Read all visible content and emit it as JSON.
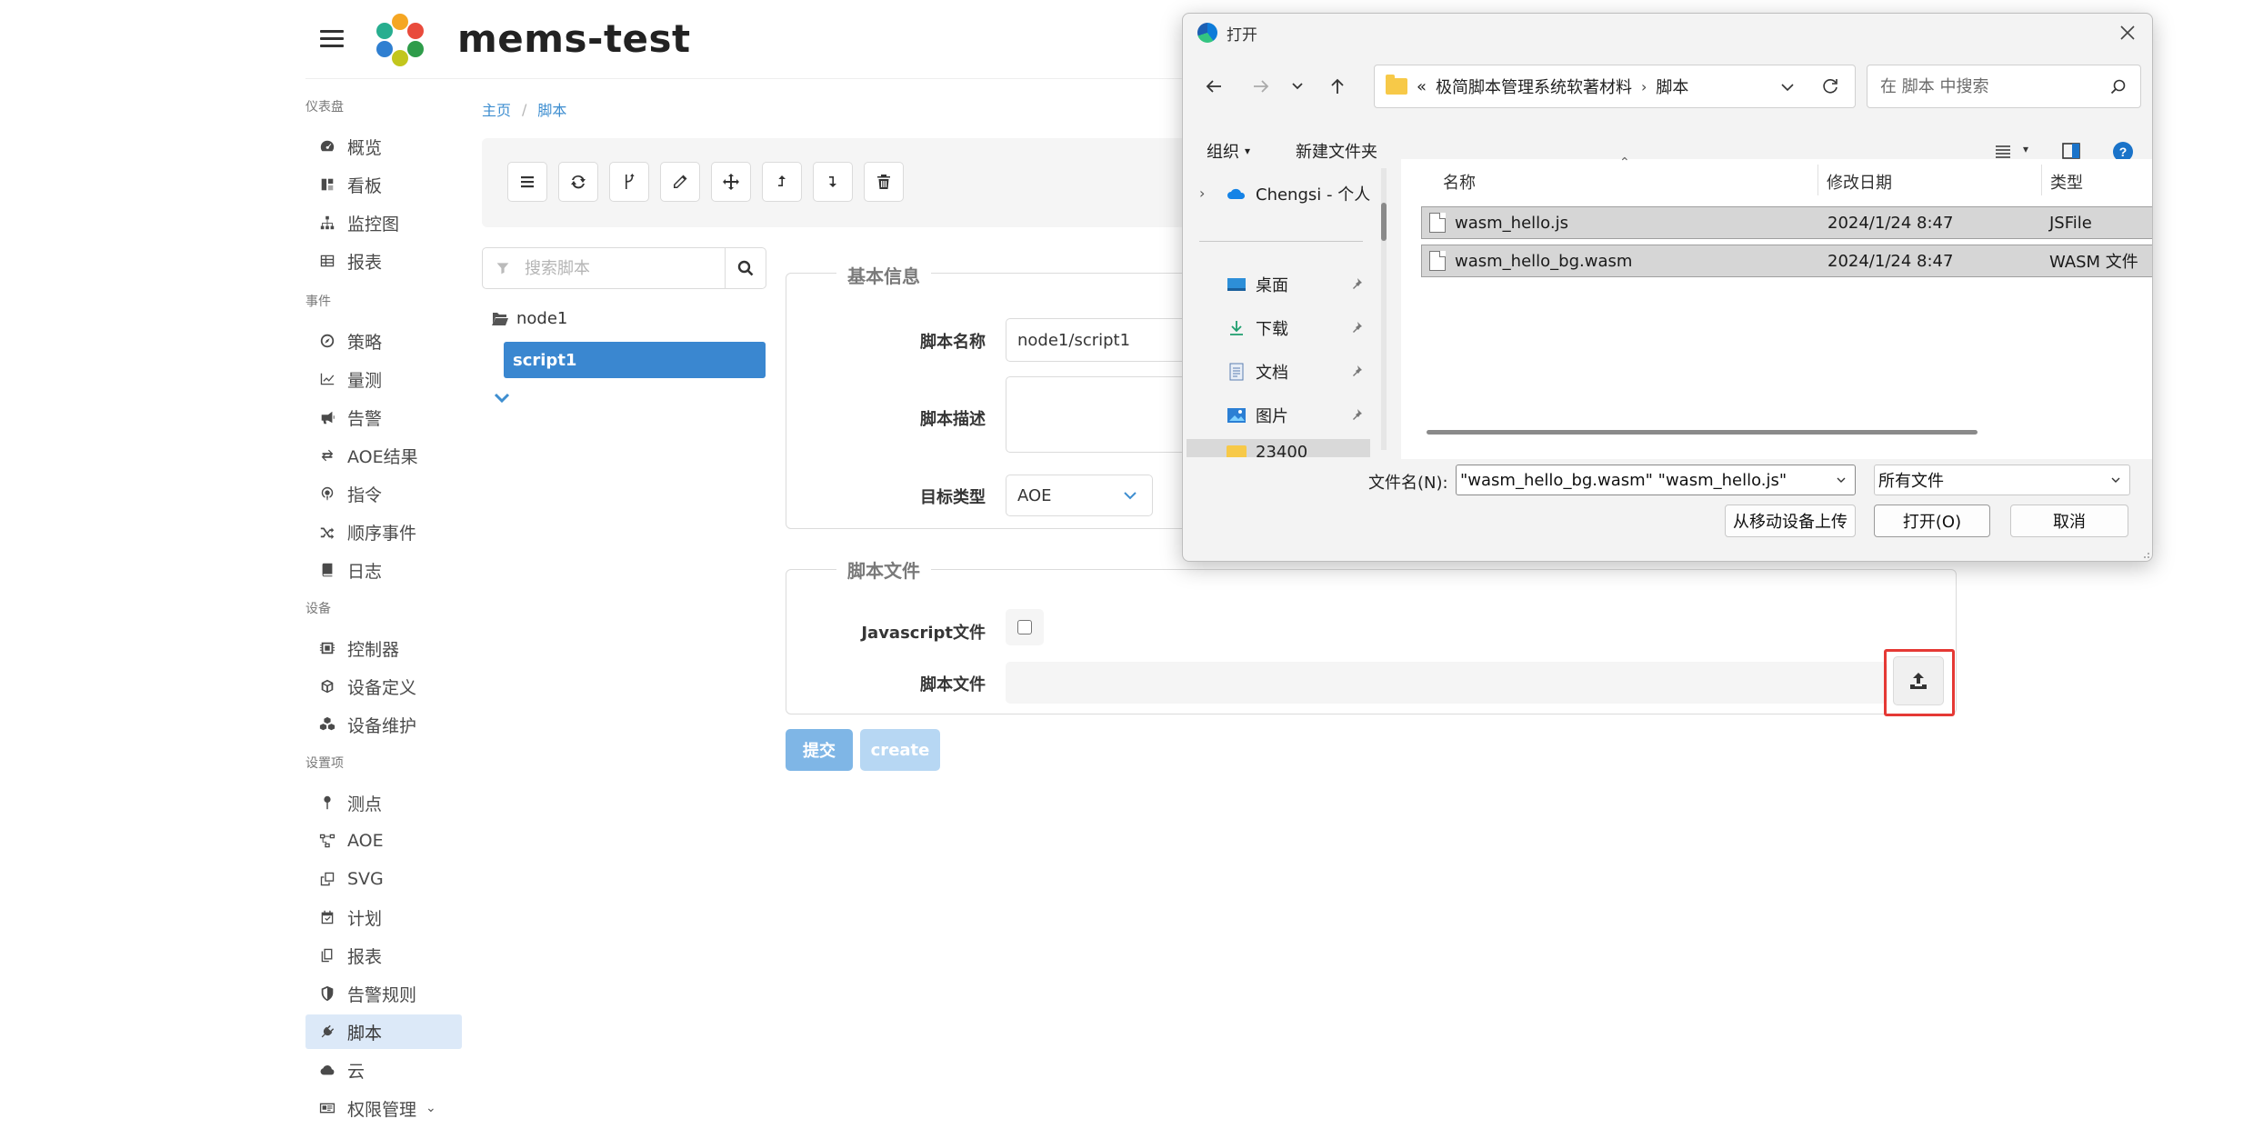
{
  "app": {
    "title": "mems-test"
  },
  "sidebar": {
    "groups": [
      {
        "label": "仪表盘",
        "items": [
          {
            "label": "概览",
            "icon": "dashboard-icon"
          },
          {
            "label": "看板",
            "icon": "kanban-icon"
          },
          {
            "label": "监控图",
            "icon": "sitemap-icon"
          },
          {
            "label": "报表",
            "icon": "table-icon"
          }
        ]
      },
      {
        "label": "事件",
        "items": [
          {
            "label": "策略",
            "icon": "compass-icon"
          },
          {
            "label": "量测",
            "icon": "chart-line-icon"
          },
          {
            "label": "告警",
            "icon": "bullhorn-icon"
          },
          {
            "label": "AOE结果",
            "icon": "exchange-icon"
          },
          {
            "label": "指令",
            "icon": "podcast-icon"
          },
          {
            "label": "顺序事件",
            "icon": "random-icon"
          },
          {
            "label": "日志",
            "icon": "book-icon"
          }
        ]
      },
      {
        "label": "设备",
        "items": [
          {
            "label": "控制器",
            "icon": "controller-icon"
          },
          {
            "label": "设备定义",
            "icon": "cube-icon"
          },
          {
            "label": "设备维护",
            "icon": "cubes-icon"
          }
        ]
      },
      {
        "label": "设置项",
        "items": [
          {
            "label": "测点",
            "icon": "map-pin-icon"
          },
          {
            "label": "AOE",
            "icon": "project-diagram-icon"
          },
          {
            "label": "SVG",
            "icon": "clone-icon"
          },
          {
            "label": "计划",
            "icon": "calendar-check-icon"
          },
          {
            "label": "报表",
            "icon": "copy-icon"
          },
          {
            "label": "告警规则",
            "icon": "shield-icon"
          },
          {
            "label": "脚本",
            "icon": "plug-icon"
          },
          {
            "label": "云",
            "icon": "cloud-icon"
          },
          {
            "label": "权限管理",
            "icon": "id-card-icon"
          }
        ]
      }
    ]
  },
  "breadcrumb": {
    "home": "主页",
    "current": "脚本"
  },
  "tree": {
    "search_placeholder": "搜索脚本",
    "node": "node1",
    "leaf": "script1"
  },
  "basic_info": {
    "legend": "基本信息",
    "name_label": "脚本名称",
    "name_value": "node1/script1",
    "desc_label": "脚本描述",
    "desc_value": "",
    "target_label": "目标类型",
    "target_value": "AOE"
  },
  "script_file": {
    "legend": "脚本文件",
    "js_label": "Javascript文件",
    "file_label": "脚本文件"
  },
  "actions": {
    "submit": "提交",
    "create": "create"
  },
  "colors": {
    "primary": "#3e8ed0",
    "primary_light": "#a8cdf0",
    "highlight": "#e53935"
  },
  "dialog": {
    "title": "打开",
    "address": {
      "prefix": "«",
      "parent": "极简脚本管理系统软著材料",
      "current": "脚本"
    },
    "search_placeholder": "在 脚本 中搜索",
    "organize": "组织",
    "new_folder": "新建文件夹",
    "nav": [
      {
        "label": "Chengsi - 个人",
        "icon": "onedrive-icon"
      },
      {
        "label": "桌面",
        "icon": "desktop-icon"
      },
      {
        "label": "下载",
        "icon": "download-icon"
      },
      {
        "label": "文档",
        "icon": "documents-icon"
      },
      {
        "label": "图片",
        "icon": "pictures-icon"
      },
      {
        "label": "23400",
        "icon": "folder-icon"
      }
    ],
    "columns": {
      "name": "名称",
      "date": "修改日期",
      "type": "类型"
    },
    "files": [
      {
        "name": "wasm_hello.js",
        "date": "2024/1/24 8:47",
        "type": "JSFile"
      },
      {
        "name": "wasm_hello_bg.wasm",
        "date": "2024/1/24 8:47",
        "type": "WASM 文件"
      }
    ],
    "filename_label": "文件名(N):",
    "filename_value": "\"wasm_hello_bg.wasm\" \"wasm_hello.js\"",
    "filter_value": "所有文件",
    "upload_mobile": "从移动设备上传",
    "open": "打开(O)",
    "cancel": "取消"
  }
}
